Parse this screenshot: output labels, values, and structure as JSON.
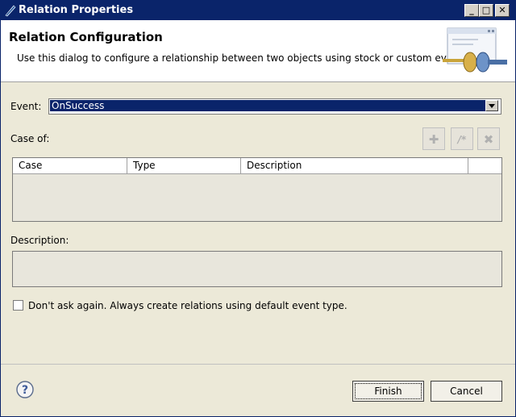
{
  "window": {
    "title": "Relation Properties"
  },
  "titlebar": {
    "minimize": "_",
    "maximize": "□",
    "close": "✕"
  },
  "banner": {
    "title": "Relation Configuration",
    "description": "Use this dialog to configure a relationship between two objects using stock or custom event"
  },
  "event": {
    "label": "Event:",
    "value": "OnSuccess"
  },
  "case_of": {
    "label": "Case of:",
    "toolbar": {
      "add": "✚",
      "edit": "/*",
      "delete": "✖"
    },
    "columns": [
      "Case",
      "Type",
      "Description"
    ],
    "rows": []
  },
  "description": {
    "label": "Description:",
    "value": ""
  },
  "dont_ask": {
    "label": "Don't ask again. Always create relations using default event type.",
    "checked": false
  },
  "footer": {
    "help": "?",
    "finish": "Finish",
    "cancel": "Cancel"
  },
  "colors": {
    "title_bar": "#0a246a",
    "selection": "#0a246a",
    "dialog_bg": "#ece9d8"
  }
}
